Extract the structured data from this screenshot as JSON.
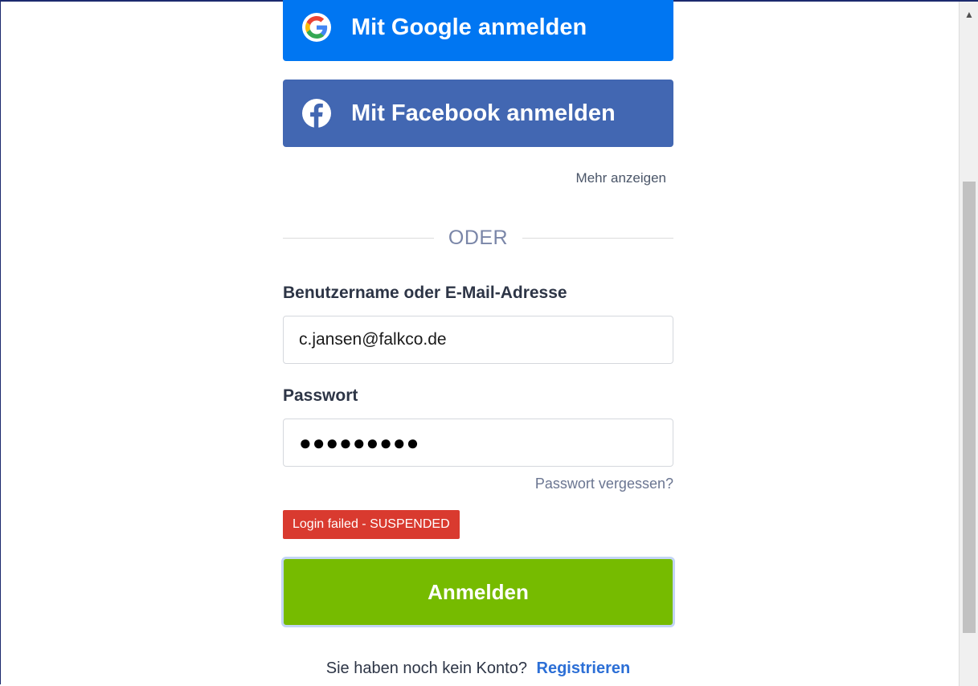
{
  "social": {
    "google_label": "Mit Google anmelden",
    "facebook_label": "Mit Facebook anmelden",
    "more_label": "Mehr anzeigen"
  },
  "divider": {
    "text": "ODER"
  },
  "form": {
    "username_label": "Benutzername oder E-Mail-Adresse",
    "username_value": "c.jansen@falkco.de",
    "password_label": "Passwort",
    "password_value": "●●●●●●●●●",
    "forgot_label": "Passwort vergessen?",
    "error_text": "Login failed - SUSPENDED",
    "submit_label": "Anmelden"
  },
  "footer": {
    "prompt": "Sie haben noch kein Konto?",
    "register_label": "Registrieren"
  },
  "colors": {
    "google_blue": "#0076f2",
    "facebook_blue": "#4267b2",
    "submit_green": "#76bb00",
    "error_red": "#d93a2f",
    "link_blue": "#2c6fd6"
  }
}
